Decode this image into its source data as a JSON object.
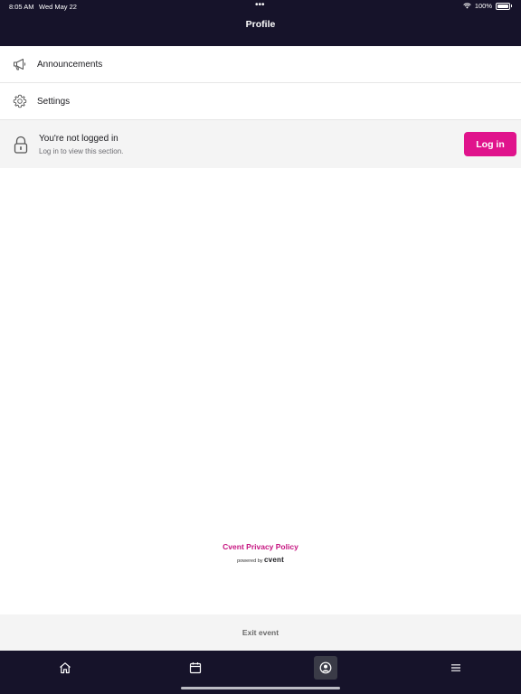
{
  "status_bar": {
    "time": "8:05 AM",
    "date": "Wed May 22",
    "dots": "•••",
    "battery": "100%"
  },
  "header": {
    "title": "Profile"
  },
  "menu": {
    "items": [
      {
        "label": "Announcements",
        "icon": "megaphone-icon"
      },
      {
        "label": "Settings",
        "icon": "gear-icon"
      }
    ]
  },
  "login_panel": {
    "title": "You're not logged in",
    "subtitle": "Log in to view this section.",
    "button_label": "Log in",
    "icon": "lock-icon"
  },
  "footer": {
    "privacy_link": "Cvent Privacy Policy",
    "powered_by": "powered by",
    "brand": "cvent"
  },
  "exit_bar": {
    "label": "Exit event"
  },
  "tab_bar": {
    "tabs": [
      {
        "icon": "home-icon",
        "active": false
      },
      {
        "icon": "calendar-icon",
        "active": false
      },
      {
        "icon": "profile-icon",
        "active": true
      },
      {
        "icon": "menu-icon",
        "active": false
      }
    ]
  },
  "colors": {
    "header_bg": "#16132a",
    "accent": "#e0138c",
    "link": "#c61480",
    "panel_bg": "#f4f4f4"
  }
}
